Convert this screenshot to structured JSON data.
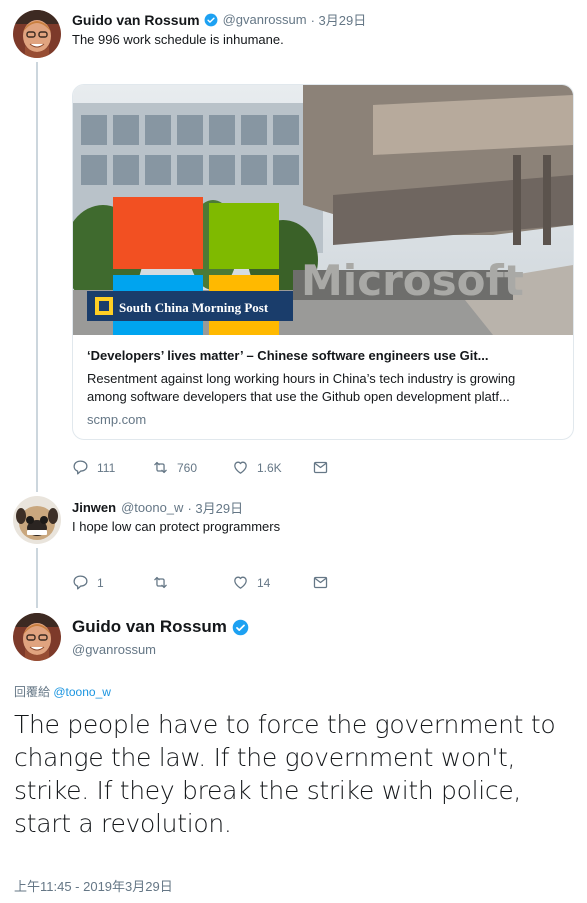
{
  "tweet1": {
    "author_name": "Guido van Rossum",
    "handle": "@gvanrossum",
    "date": "· 3月29日",
    "text": "The 996 work schedule is inhumane.",
    "card": {
      "publisher_logo": "South China Morning Post",
      "image_sign_text": "Microsoft",
      "title": "‘Developers’ lives matter’ – Chinese software engineers use Git...",
      "desc_line1": "Resentment against long working hours in China’s tech industry is growing",
      "desc_line2": "among software developers that use the Github open development platf...",
      "domain": "scmp.com"
    },
    "actions": {
      "reply_count": "111",
      "retweet_count": "760",
      "like_count": "1.6K"
    }
  },
  "tweet2": {
    "author_name": "Jinwen",
    "handle": "@toono_w",
    "date": "· 3月29日",
    "text": "I hope low can protect programmers",
    "actions": {
      "reply_count": "1",
      "retweet_count": "",
      "like_count": "14"
    }
  },
  "main_tweet": {
    "author_name": "Guido van Rossum",
    "handle": "@gvanrossum",
    "reply_prefix": "回覆給",
    "reply_to": "@toono_w",
    "text": "The people have to force the government to change the law. If the government won't, strike. If they break the strike with police, start a revolution.",
    "timestamp": "上午11:45 - 2019年3月29日"
  },
  "colors": {
    "verified": "#1da1f2",
    "link": "#1b95e0",
    "muted": "#657786",
    "thread_line": "#ccd6dd"
  }
}
